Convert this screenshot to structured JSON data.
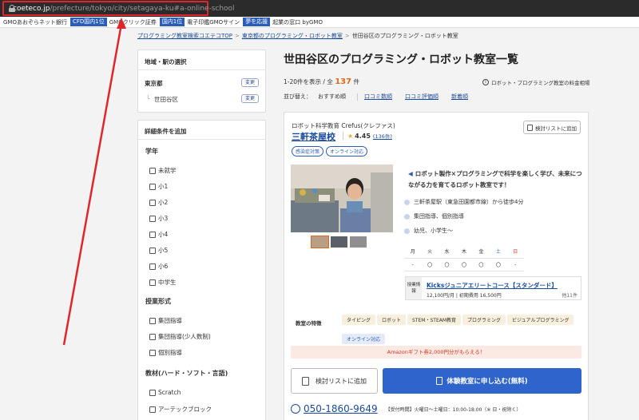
{
  "browser": {
    "url_host": "coeteco.jp",
    "url_path": "/prefecture/tokyo/city/setagaya-ku#a-online-school"
  },
  "adbar": [
    {
      "kind": "txt",
      "text": "GMOあおぞらネット銀行"
    },
    {
      "kind": "tag",
      "text": "CFD国内1位"
    },
    {
      "kind": "txt",
      "text": "GMOクリック証券"
    },
    {
      "kind": "tag",
      "text": "国内1位"
    },
    {
      "kind": "txt",
      "text": "電子印鑑GMOサイン"
    },
    {
      "kind": "tag",
      "text": "夢を応援"
    },
    {
      "kind": "txt",
      "text": "起業の窓口 byGMO"
    }
  ],
  "breadcrumbs": [
    "プログラミング教室検索コエテコTOP",
    "東京都のプログラミング・ロボット教室",
    "世田谷区のプログラミング・ロボット教室"
  ],
  "area_panel": {
    "heading": "地域・駅の選択",
    "pref": "東京都",
    "city": "世田谷区",
    "change_label": "変更"
  },
  "filter_panel": {
    "heading": "詳細条件を追加",
    "grade_title": "学年",
    "grades": [
      "未就学",
      "小1",
      "小2",
      "小3",
      "小4",
      "小5",
      "小6",
      "中学生"
    ],
    "format_title": "授業形式",
    "formats": [
      "集団指導",
      "集団指導(少人数制)",
      "個別指導"
    ],
    "material_title": "教材(ハード・ソフト・言語)",
    "materials": [
      "Scratch",
      "アーテックブロック"
    ]
  },
  "main": {
    "title": "世田谷区のプログラミング・ロボット教室一覧",
    "count_prefix": "1-20件を表示 / 全",
    "count_total": "137",
    "count_suffix": "件",
    "about_link": "ロボット・プログラミング教室の料金相場",
    "sort_label": "並び替え：",
    "sort_current": "おすすめ順",
    "sort_options": [
      "口コミ数順",
      "口コミ評価順",
      "新着順"
    ]
  },
  "card": {
    "corp": "ロボット科学教育 Crefus(クレファス)",
    "school": "三軒茶屋校",
    "rating": "4.45",
    "reviews": "(136件)",
    "save_small": "検討リストに追加",
    "badges": [
      "感染症対策",
      "オンライン対応"
    ],
    "description": "ロボット製作×プログラミングで科学を楽しく学び、未来につながる力を育てるロボット教室です！",
    "station": "三軒茶屋駅（東急田園都市線）から徒歩4分",
    "format": "集団指導、個別指導",
    "ages": "幼児、小学生〜",
    "week_days": [
      "月",
      "火",
      "水",
      "木",
      "金",
      "土",
      "日"
    ],
    "week_marks": [
      "-",
      "〇",
      "〇",
      "〇",
      "〇",
      "〇",
      "-"
    ],
    "course_label": "授業情報",
    "course_name": "Kicksジュニアエリートコース【スタンダード】",
    "course_price": "12,100円/月 | 初期費用 16,500円",
    "course_count": "他11件",
    "feature_label": "教室の特徴",
    "features": [
      "タイピング",
      "ロボット",
      "STEM・STEAM教育",
      "プログラミング",
      "ビジュアルプログラミング",
      "オンライン対応"
    ],
    "amazon": "Amazonギフト券2,000円分がもらえる！",
    "save_big": "検討リストに追加",
    "apply": "体験教室に申し込む(無料)",
    "phone": "050-1860-9649",
    "hours": "【受付時間】火曜日〜土曜日：10:00-18:00（※ 日・祝除く）"
  },
  "colors": {
    "accent": "#2f64cc",
    "link": "#1a4a9c",
    "highlight": "#e0262b",
    "count": "#e06a1a"
  }
}
